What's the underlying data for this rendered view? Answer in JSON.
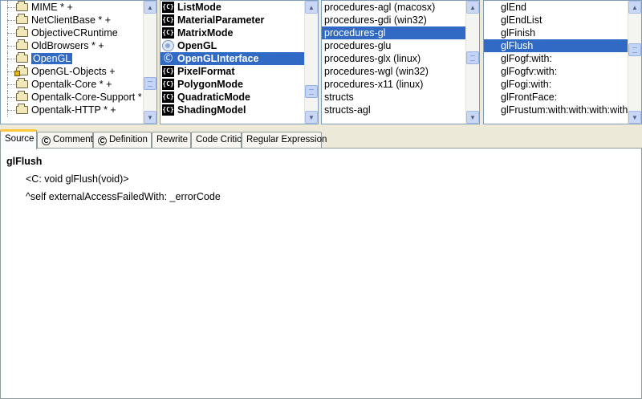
{
  "packages": {
    "items": [
      {
        "label": "MIME * +",
        "locked": false
      },
      {
        "label": "NetClientBase * +",
        "locked": false
      },
      {
        "label": "ObjectiveCRuntime",
        "locked": false
      },
      {
        "label": "OldBrowsers * +",
        "locked": false
      },
      {
        "label": "OpenGL",
        "locked": false,
        "selected": true
      },
      {
        "label": "OpenGL-Objects +",
        "locked": true
      },
      {
        "label": "Opentalk-Core * +",
        "locked": false
      },
      {
        "label": "Opentalk-Core-Support *",
        "locked": false
      },
      {
        "label": "Opentalk-HTTP * +",
        "locked": false
      }
    ],
    "scroll_position": 0.75
  },
  "classes": {
    "items": [
      {
        "label": "ListMode",
        "icon": "class-icon"
      },
      {
        "label": "MaterialParameter",
        "icon": "class-icon"
      },
      {
        "label": "MatrixMode",
        "icon": "class-icon"
      },
      {
        "label": "OpenGL",
        "icon": "namespace-icon"
      },
      {
        "label": "OpenGLInterface",
        "icon": "c-interface-icon",
        "selected": true
      },
      {
        "label": "PixelFormat",
        "icon": "class-icon"
      },
      {
        "label": "PolygonMode",
        "icon": "class-icon"
      },
      {
        "label": "QuadraticMode",
        "icon": "class-icon"
      },
      {
        "label": "ShadingModel",
        "icon": "class-icon"
      }
    ],
    "class_icon_text": "{C}",
    "scroll_position": 0.85
  },
  "protocols": {
    "items": [
      {
        "label": "procedures-agl (macosx)"
      },
      {
        "label": "procedures-gdi (win32)"
      },
      {
        "label": "procedures-gl",
        "selected": true
      },
      {
        "label": "procedures-glu"
      },
      {
        "label": "procedures-glx (linux)"
      },
      {
        "label": "procedures-wgl (win32)"
      },
      {
        "label": "procedures-x11 (linux)"
      },
      {
        "label": "structs"
      },
      {
        "label": "structs-agl"
      }
    ],
    "scroll_position": 0.45
  },
  "methods": {
    "items": [
      {
        "label": "glEnd"
      },
      {
        "label": "glEndList"
      },
      {
        "label": "glFinish"
      },
      {
        "label": "glFlush",
        "selected": true
      },
      {
        "label": "glFogf:with:"
      },
      {
        "label": "glFogfv:with:"
      },
      {
        "label": "glFogi:with:"
      },
      {
        "label": "glFrontFace:"
      },
      {
        "label": "glFrustum:with:with:with:with:"
      }
    ],
    "scroll_position": 0.35
  },
  "tabs": [
    {
      "label": "Source",
      "icon": "",
      "active": true
    },
    {
      "label": "Comment",
      "icon": "c-icon"
    },
    {
      "label": "Definition",
      "icon": "c-icon"
    },
    {
      "label": "Rewrite",
      "icon": ""
    },
    {
      "label": "Code Critic",
      "icon": ""
    },
    {
      "label": "Regular Expression",
      "icon": ""
    }
  ],
  "source": {
    "selector": "glFlush",
    "lines": [
      "<C: void glFlush(void)>",
      "^self externalAccessFailedWith: _errorCode"
    ]
  },
  "colors": {
    "selection": "#316ac5",
    "active_tab_accent": "#ffc83c"
  }
}
